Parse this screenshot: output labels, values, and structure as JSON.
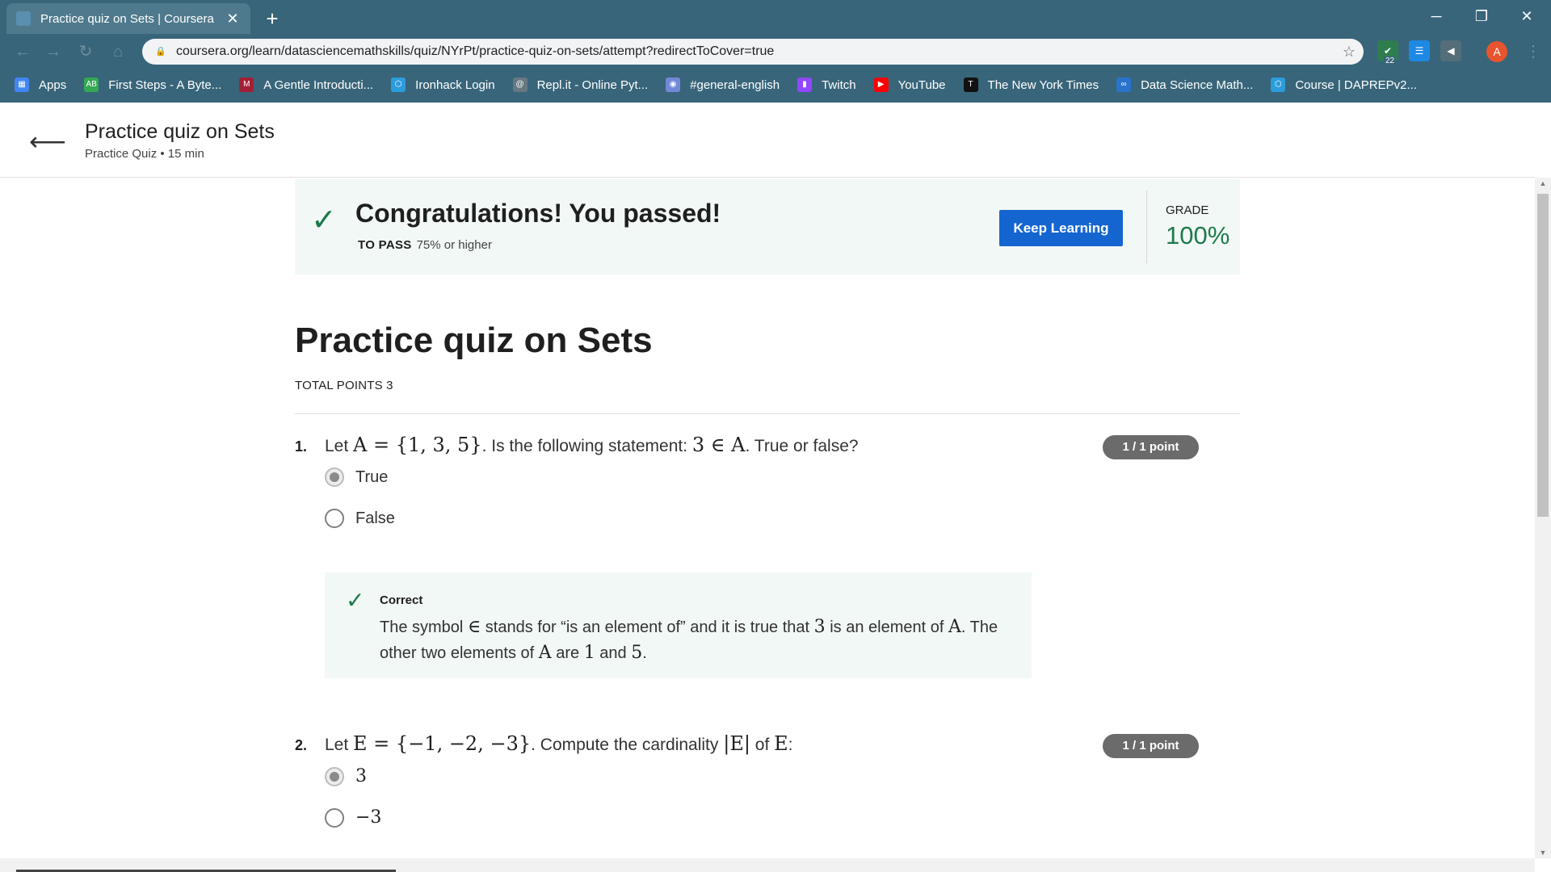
{
  "browser": {
    "tab_title": "Practice quiz on Sets | Coursera",
    "tab_close": "✕",
    "new_tab": "+",
    "url": "coursera.org/learn/datasciencemathskills/quiz/NYrPt/practice-quiz-on-sets/attempt?redirectToCover=true",
    "extension_badge": "22",
    "avatar_letter": "A",
    "bookmarks": [
      {
        "label": "Apps",
        "icon": "apps-grid-icon",
        "color": "#4285f4"
      },
      {
        "label": "First Steps - A Byte...",
        "icon": "ab-icon",
        "color": "#34a853"
      },
      {
        "label": "A Gentle Introducti...",
        "icon": "mit-ocw-icon",
        "color": "#a31f34"
      },
      {
        "label": "Ironhack Login",
        "icon": "ironhack-icon",
        "color": "#2d9cdb"
      },
      {
        "label": "Repl.it - Online Pyt...",
        "icon": "replit-icon",
        "color": "#667881"
      },
      {
        "label": "#general-english",
        "icon": "discord-icon",
        "color": "#7289da"
      },
      {
        "label": "Twitch",
        "icon": "twitch-icon",
        "color": "#9146ff"
      },
      {
        "label": "YouTube",
        "icon": "youtube-icon",
        "color": "#ff0000"
      },
      {
        "label": "The New York Times",
        "icon": "nyt-icon",
        "color": "#111111"
      },
      {
        "label": "Data Science Math...",
        "icon": "coursera-icon",
        "color": "#2a73cc"
      },
      {
        "label": "Course | DAPREPv2...",
        "icon": "course-icon",
        "color": "#2d9cdb"
      }
    ]
  },
  "header": {
    "title": "Practice quiz on Sets",
    "subtitle": "Practice Quiz • 15 min"
  },
  "result": {
    "title": "Congratulations! You passed!",
    "to_pass_label": "TO PASS",
    "to_pass_value": "75% or higher",
    "button": "Keep Learning",
    "grade_label": "GRADE",
    "grade_value": "100%",
    "success_color": "#1e7a4a"
  },
  "quiz": {
    "title": "Practice quiz on Sets",
    "total_points": "TOTAL POINTS 3",
    "questions": [
      {
        "number": "1.",
        "text_a": "Let ",
        "math_a": "A = {1, 3, 5}",
        "text_b": ". Is the following statement: ",
        "math_b": "3 ∈ A",
        "text_c": ". True or false?",
        "points": "1 / 1 point",
        "options": [
          {
            "label": "True",
            "selected": true
          },
          {
            "label": "False",
            "selected": false
          }
        ],
        "feedback": {
          "label": "Correct",
          "t1": "The symbol ",
          "m1": "∈",
          "t2": " stands for “is an element of” and it is true that ",
          "m2": "3",
          "t3": " is an element of ",
          "m3": "A",
          "t4": ". The other two elements of ",
          "m4": "A",
          "t5": " are ",
          "m5": "1",
          "t6": " and ",
          "m6": "5",
          "t7": "."
        }
      },
      {
        "number": "2.",
        "text_a": "Let ",
        "math_a": "E = {−1, −2, −3}",
        "text_b": ". Compute the cardinality ",
        "math_b": "|E|",
        "text_c": " of ",
        "math_c": "E",
        "text_d": ":",
        "points": "1 / 1 point",
        "options": [
          {
            "label": "3",
            "selected": true
          },
          {
            "label": "−3",
            "selected": false
          }
        ]
      }
    ]
  }
}
